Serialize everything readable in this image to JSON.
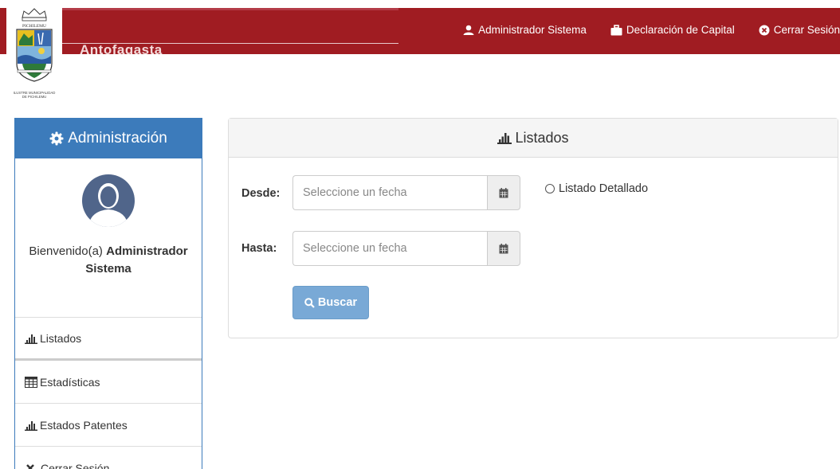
{
  "header": {
    "brand_text": "Antofagasta",
    "nav": [
      {
        "label": "Administrador Sistema",
        "icon": "user-icon"
      },
      {
        "label": "Declaración de Capital",
        "icon": "briefcase-icon"
      },
      {
        "label": "Cerrar Sesión",
        "icon": "close-circle-icon"
      }
    ],
    "colors": {
      "bar": "#a01c22",
      "accent": "#3c7bbb"
    }
  },
  "logo": {
    "top_text": "PICHILEMU",
    "caption_line1": "ILUSTRE MUNICIPALIDAD",
    "caption_line2": "DE PICHILEMU"
  },
  "sidebar": {
    "title": "Administración",
    "title_icon": "gear-icon",
    "welcome_prefix": "Bienvenido(a)",
    "user_name": "Administrador Sistema",
    "items": [
      {
        "label": "Listados",
        "icon": "bar-chart-icon"
      },
      {
        "label": "Estadísticas",
        "icon": "table-icon"
      },
      {
        "label": "Estados Patentes",
        "icon": "bar-chart-icon"
      },
      {
        "label": "Cerrar Sesión",
        "icon": "close-icon"
      }
    ]
  },
  "panel": {
    "title": "Listados",
    "title_icon": "bar-chart-icon",
    "desde_label": "Desde:",
    "hasta_label": "Hasta:",
    "desde_placeholder": "Seleccione un fecha",
    "hasta_placeholder": "Seleccione un fecha",
    "radio_label": "Listado Detallado",
    "button_label": "Buscar",
    "button_icon": "search-icon"
  }
}
